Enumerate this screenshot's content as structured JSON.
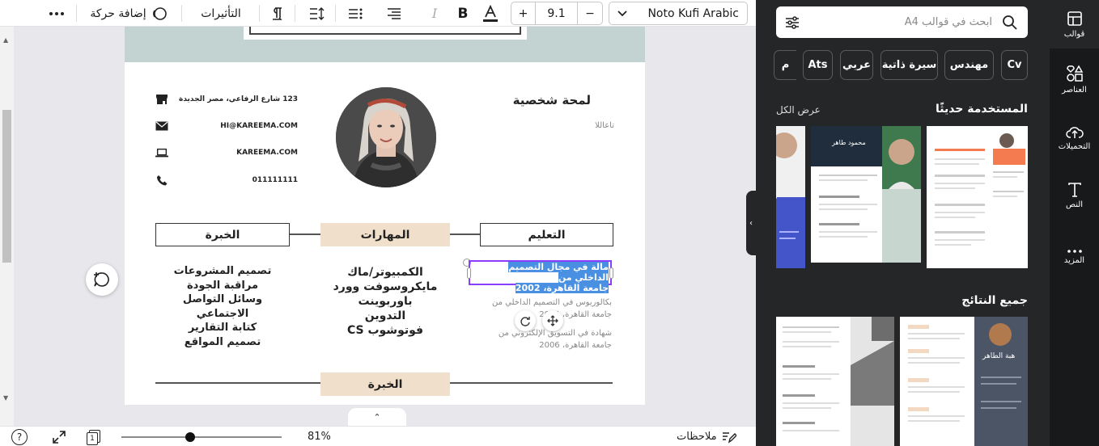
{
  "toolbar": {
    "more_icon": "ellipsis-icon",
    "animate_label": "إضافة حركة",
    "effects_label": "التأثيرات",
    "font_size": "9.1",
    "font_name": "Noto Kufi Arabic",
    "size_plus": "+",
    "size_minus": "−"
  },
  "resume": {
    "profile_title": "لمحة شخصية",
    "profile_subtitle": "تاعاللا",
    "contacts": [
      {
        "icon": "store-icon",
        "text": "123 شارع الرفاعي، مصر الجديدة"
      },
      {
        "icon": "mail-icon",
        "text": "HI@KAREEMA.COM"
      },
      {
        "icon": "laptop-icon",
        "text": "KAREEMA.COM"
      },
      {
        "icon": "phone-icon",
        "text": "011111111"
      }
    ],
    "sections": {
      "education": "التعليم",
      "skills": "المهارات",
      "experience": "الخبرة",
      "experience_bottom": "الخبرة"
    },
    "education_selected": [
      "مالة في مجال التصميم الداخلي من",
      "جامعة القاهرة، 2002"
    ],
    "education_items": [
      "بكالوريوس في التصميم الداخلي من",
      "جامعة القاهرة، 2004",
      "شهادة في التسويق الإلكتروني من",
      "جامعة القاهرة، 2006"
    ],
    "skills": [
      "الكمبيوتر/ماك",
      "مايكروسوفت وورد",
      "باوربوينت",
      "التدوين",
      "فوتوشوب CS"
    ],
    "experience": [
      "تصميم المشروعات",
      "مراقبة الجودة",
      "وسائل التواصل",
      "الاجتماعي",
      "كتابة التقارير",
      "تصميم المواقع"
    ]
  },
  "bottombar": {
    "help": "?",
    "page_number": "1",
    "zoom_value": 0.43,
    "zoom_label": "81%",
    "notes_label": "ملاحظات"
  },
  "panel": {
    "search_placeholder": "ابحث في قوالب A4",
    "chips": [
      "Cv",
      "مهندس",
      "سيرة ذاتية",
      "عربي",
      "Ats",
      "م"
    ],
    "recent_heading": "المستخدمة حديثًا",
    "see_all": "عرض الكل",
    "all_results_heading": "جميع النتائج",
    "thumb_names": [
      "محمود طاهر",
      "هبة الطاهر"
    ]
  },
  "rail": {
    "items": [
      {
        "icon": "templates-icon",
        "label": "قوالب"
      },
      {
        "icon": "elements-icon",
        "label": "العناصر"
      },
      {
        "icon": "uploads-icon",
        "label": "التحميلات"
      },
      {
        "icon": "text-icon",
        "label": "النص"
      },
      {
        "icon": "more-icon",
        "label": "المزيد"
      }
    ]
  },
  "colors": {
    "accent": "#8b3dff",
    "panel_bg": "#252627",
    "rail_bg": "#18191b",
    "section_fill": "#f0dfcb",
    "header_band": "#c2d3d1"
  }
}
